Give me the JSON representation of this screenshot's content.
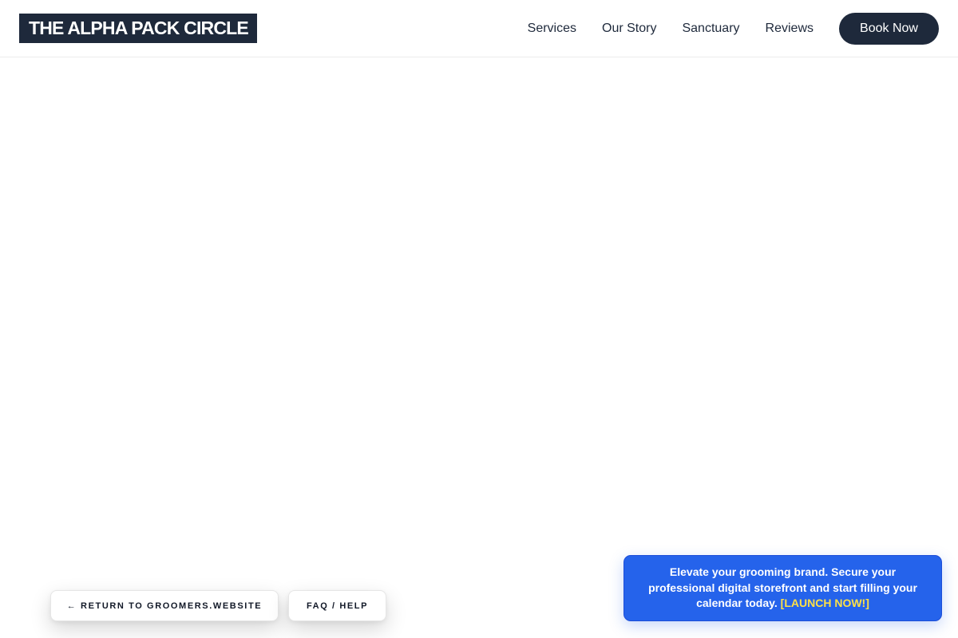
{
  "header": {
    "logo_text": "THE ALPHA PACK CIRCLE",
    "nav": [
      {
        "label": "Services"
      },
      {
        "label": "Our Story"
      },
      {
        "label": "Sanctuary"
      },
      {
        "label": "Reviews"
      }
    ],
    "cta_label": "Book Now"
  },
  "floating_links": {
    "return_label": "← RETURN TO GROOMERS.WEBSITE",
    "faq_label": "FAQ / HELP"
  },
  "promo": {
    "message": "Elevate your grooming brand. Secure your professional digital storefront and start filling your calendar today.",
    "cta_label": "[LAUNCH NOW!]"
  },
  "colors": {
    "brand_dark": "#1e293b",
    "promo_blue": "#2563eb",
    "promo_cta_yellow": "#fde047"
  }
}
